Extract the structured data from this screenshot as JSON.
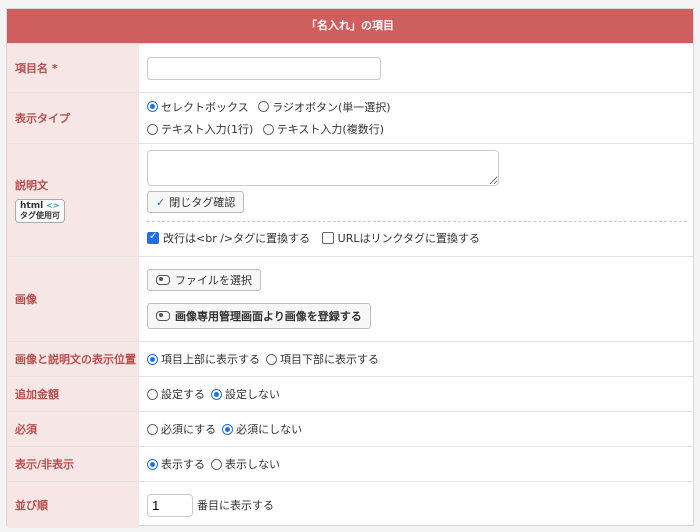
{
  "header": {
    "title": "「名入れ」の項目"
  },
  "rows": {
    "item_name": {
      "label": "項目名",
      "required_mark": "*",
      "value": ""
    },
    "display_type": {
      "label": "表示タイプ",
      "options": [
        "セレクトボックス",
        "ラジオボタン(単一選択)",
        "テキスト入力(1行)",
        "テキスト入力(複数行)"
      ],
      "selected": "セレクトボックス"
    },
    "description": {
      "label": "説明文",
      "tag_badge": {
        "line1": "html",
        "arrows": "<>",
        "line2": "タグ使用可"
      },
      "textarea_value": "",
      "check_tag_button": "閉じタグ確認",
      "opt1": "改行は<br />タグに置換する",
      "opt2": "URLはリンクタグに置換する"
    },
    "image": {
      "label": "画像",
      "file_button": "ファイルを選択",
      "register_button": "画像専用管理画面より画像を登録する"
    },
    "image_position": {
      "label": "画像と説明文の表示位置",
      "opt1": "項目上部に表示する",
      "opt2": "項目下部に表示する"
    },
    "extra_price": {
      "label": "追加金額",
      "opt1": "設定する",
      "opt2": "設定しない"
    },
    "required": {
      "label": "必須",
      "opt1": "必須にする",
      "opt2": "必須にしない"
    },
    "visibility": {
      "label": "表示/非表示",
      "opt1": "表示する",
      "opt2": "表示しない"
    },
    "order": {
      "label": "並び順",
      "value": "1",
      "suffix": "番目に表示する"
    }
  },
  "colors": {
    "header": "#cf5f5f",
    "label_bg": "#f6e6e6",
    "label_text": "#b94f4f",
    "accent": "#1f6fe6"
  }
}
